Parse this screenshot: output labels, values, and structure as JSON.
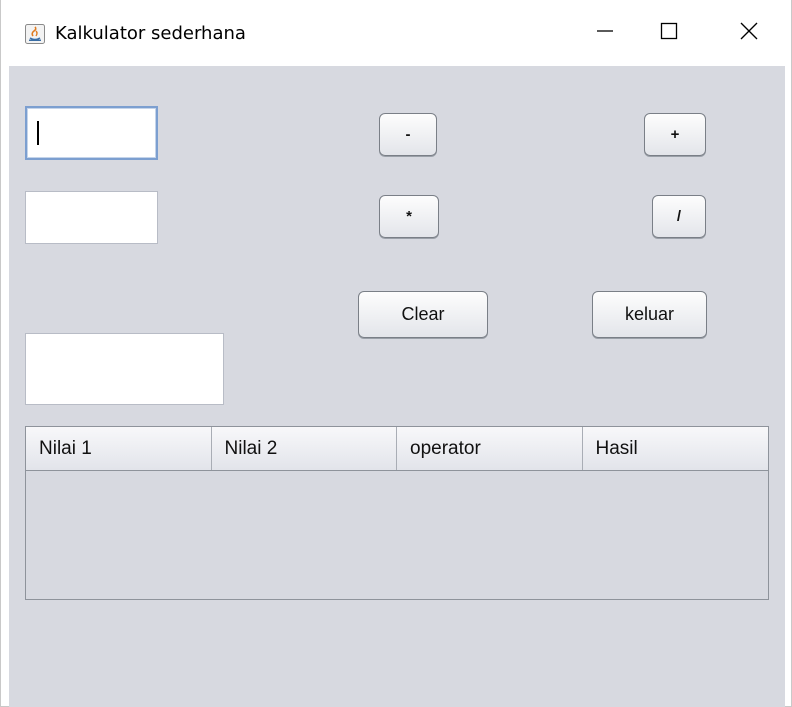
{
  "window": {
    "title": "Kalkulator sederhana",
    "icon": "java-icon"
  },
  "controls": {
    "minimize": "minimize-icon",
    "maximize": "maximize-icon",
    "close": "close-icon"
  },
  "inputs": {
    "nilai1": "",
    "nilai2": "",
    "hasil": ""
  },
  "buttons": {
    "minus": "-",
    "plus": "+",
    "multiply": "*",
    "divide": "/",
    "clear": "Clear",
    "exit": "keluar"
  },
  "table": {
    "columns": [
      "Nilai 1",
      "Nilai 2",
      "operator",
      "Hasil"
    ],
    "rows": []
  },
  "colors": {
    "panel_bg": "#d7d9e0",
    "focus_border": "#7c9fd0"
  }
}
